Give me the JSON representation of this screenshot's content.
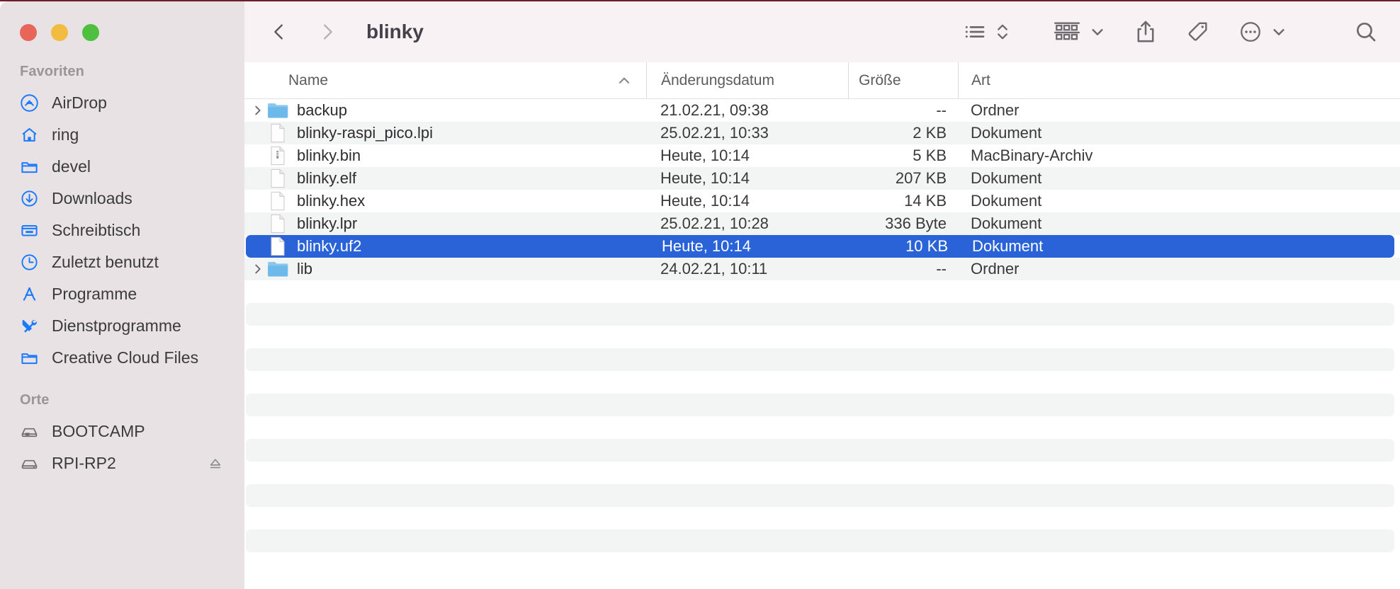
{
  "window": {
    "traffic_lights": [
      {
        "name": "close",
        "color": "#e8655a"
      },
      {
        "name": "minimize",
        "color": "#f1bc40"
      },
      {
        "name": "zoom",
        "color": "#4fbf3f"
      }
    ]
  },
  "sidebar": {
    "sections": [
      {
        "title": "Favoriten",
        "items": [
          {
            "label": "AirDrop",
            "icon": "airdrop-icon"
          },
          {
            "label": "ring",
            "icon": "home-icon"
          },
          {
            "label": "devel",
            "icon": "folder-icon"
          },
          {
            "label": "Downloads",
            "icon": "download-circle-icon"
          },
          {
            "label": "Schreibtisch",
            "icon": "desktop-icon"
          },
          {
            "label": "Zuletzt benutzt",
            "icon": "clock-icon"
          },
          {
            "label": "Programme",
            "icon": "applications-icon"
          },
          {
            "label": "Dienstprogramme",
            "icon": "utilities-icon"
          },
          {
            "label": "Creative Cloud Files",
            "icon": "folder-icon"
          }
        ]
      },
      {
        "title": "Orte",
        "items": [
          {
            "label": "BOOTCAMP",
            "icon": "drive-icon"
          },
          {
            "label": "RPI-RP2",
            "icon": "drive-icon",
            "eject": true
          }
        ]
      }
    ]
  },
  "toolbar": {
    "back_label": "Zurück",
    "forward_label": "Vorwärts",
    "title": "blinky",
    "view_label": "Listendarstellung",
    "group_label": "Gruppieren nach",
    "share_label": "Teilen",
    "tags_label": "Tags",
    "more_label": "Weitere Optionen",
    "search_label": "Suchen"
  },
  "file_list": {
    "columns": [
      {
        "key": "name",
        "label": "Name",
        "sort": "asc"
      },
      {
        "key": "date",
        "label": "Änderungsdatum"
      },
      {
        "key": "size",
        "label": "Größe"
      },
      {
        "key": "kind",
        "label": "Art"
      }
    ],
    "rows": [
      {
        "name": "backup",
        "date": "21.02.21, 09:38",
        "size": "--",
        "kind": "Ordner",
        "icon": "folder-icon",
        "expandable": true,
        "selected": false
      },
      {
        "name": "blinky-raspi_pico.lpi",
        "date": "25.02.21, 10:33",
        "size": "2 KB",
        "kind": "Dokument",
        "icon": "document-icon",
        "expandable": false,
        "selected": false
      },
      {
        "name": "blinky.bin",
        "date": "Heute, 10:14",
        "size": "5 KB",
        "kind": "MacBinary-Archiv",
        "icon": "binary-icon",
        "expandable": false,
        "selected": false
      },
      {
        "name": "blinky.elf",
        "date": "Heute, 10:14",
        "size": "207 KB",
        "kind": "Dokument",
        "icon": "document-icon",
        "expandable": false,
        "selected": false
      },
      {
        "name": "blinky.hex",
        "date": "Heute, 10:14",
        "size": "14 KB",
        "kind": "Dokument",
        "icon": "document-icon",
        "expandable": false,
        "selected": false
      },
      {
        "name": "blinky.lpr",
        "date": "25.02.21, 10:28",
        "size": "336 Byte",
        "kind": "Dokument",
        "icon": "document-icon",
        "expandable": false,
        "selected": false
      },
      {
        "name": "blinky.uf2",
        "date": "Heute, 10:14",
        "size": "10 KB",
        "kind": "Dokument",
        "icon": "document-icon",
        "expandable": false,
        "selected": true
      },
      {
        "name": "lib",
        "date": "24.02.21, 10:11",
        "size": "--",
        "kind": "Ordner",
        "icon": "folder-icon",
        "expandable": true,
        "selected": false
      }
    ],
    "empty_row_count": 12
  },
  "colors": {
    "accent_selection": "#2a63d8",
    "sidebar_bg": "#e8e2e4",
    "toolbar_bg": "#f9f2f4",
    "stripe": "#f3f4f4",
    "sidebar_icon_blue": "#1a7aff"
  }
}
